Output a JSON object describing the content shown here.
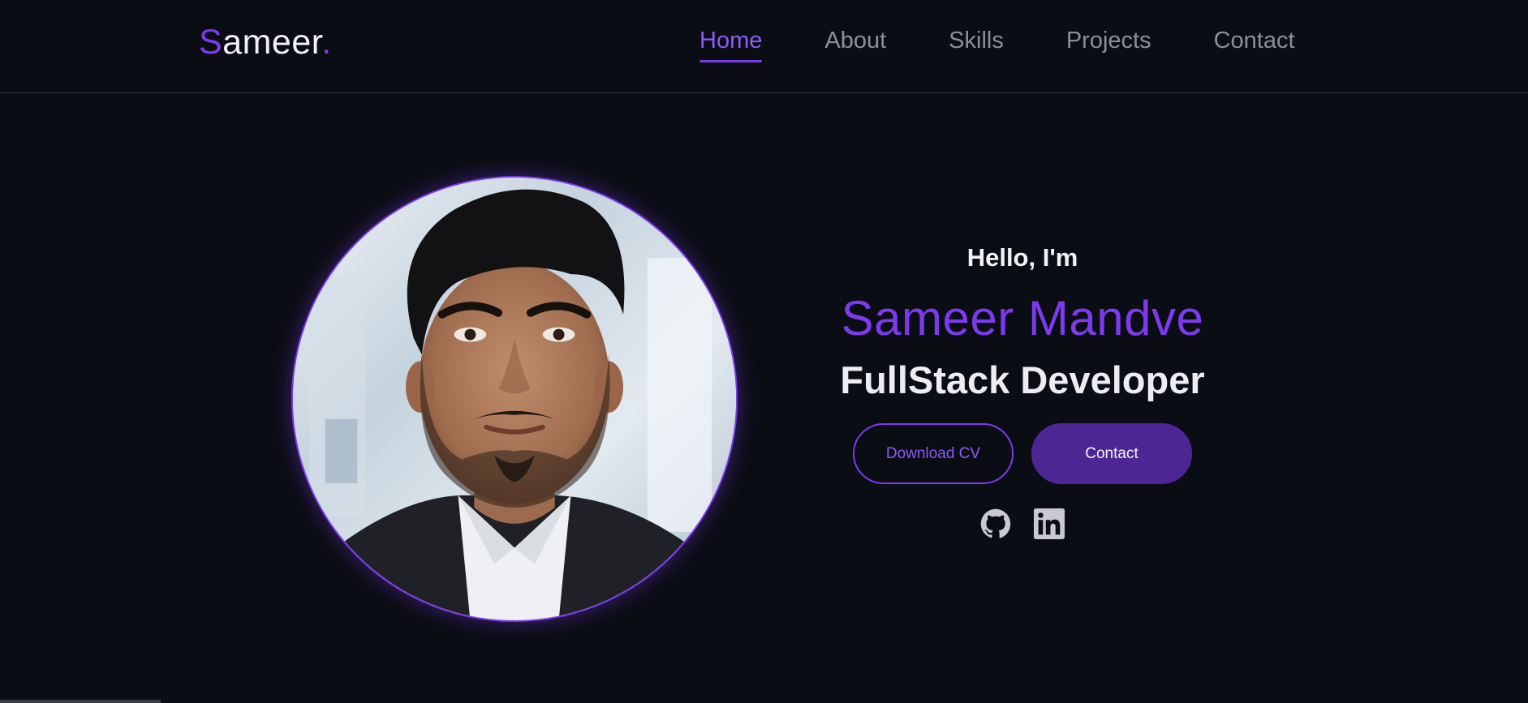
{
  "logo": {
    "first": "S",
    "rest": "ameer",
    "dot": "."
  },
  "nav": {
    "items": [
      {
        "label": "Home",
        "active": true
      },
      {
        "label": "About"
      },
      {
        "label": "Skills"
      },
      {
        "label": "Projects"
      },
      {
        "label": "Contact"
      }
    ]
  },
  "hero": {
    "greeting": "Hello, I'm",
    "name": "Sameer Mandve",
    "role": "FullStack Developer",
    "download_label": "Download CV",
    "contact_label": "Contact"
  },
  "social": {
    "icons": [
      "github-icon",
      "linkedin-icon"
    ]
  },
  "colors": {
    "accent": "#7c3aed",
    "background": "#0b0d14",
    "button_fill": "#4c2794",
    "nav_inactive": "#8d8e97"
  }
}
